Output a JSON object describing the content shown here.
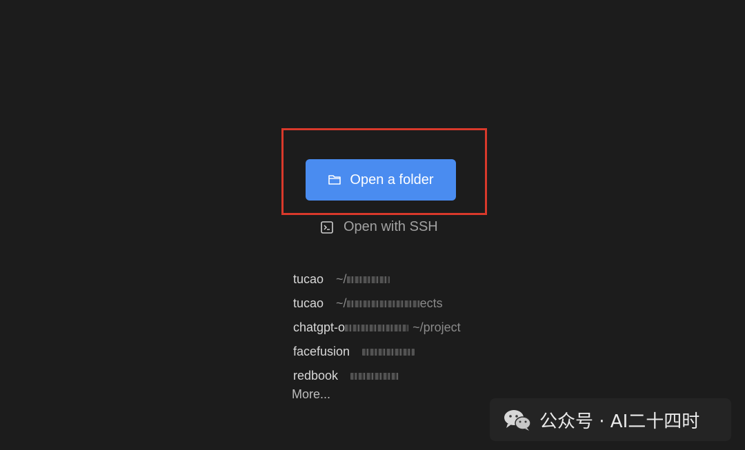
{
  "welcome": {
    "open_folder_label": "Open a folder",
    "open_ssh_label": "Open with SSH",
    "more_label": "More...",
    "accent_color": "#4a8cf0",
    "highlight_color": "#d9392b",
    "open_folder_icon": "folder-icon",
    "open_ssh_icon": "terminal-icon"
  },
  "recent_projects": [
    {
      "name": "tucao",
      "path": "~/"
    },
    {
      "name": "tucao",
      "path": "~/",
      "path_suffix": "ects"
    },
    {
      "name": "chatgpt-o",
      "path": "~/project"
    },
    {
      "name": "facefusion",
      "path": ""
    },
    {
      "name": "redbook",
      "path": ""
    }
  ],
  "watermark": {
    "text": "公众号 · AI二十四时",
    "icon": "wechat-logo-icon"
  }
}
